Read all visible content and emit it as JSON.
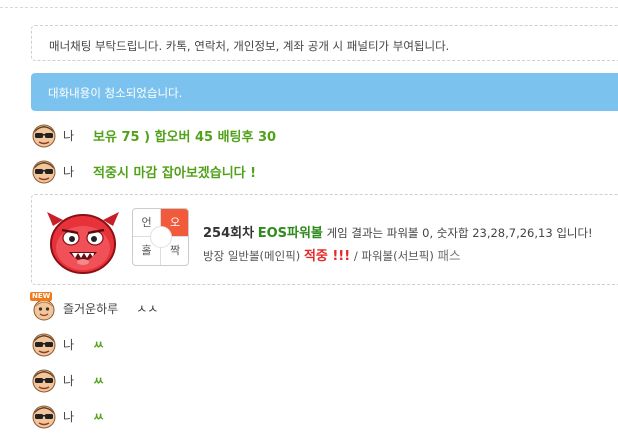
{
  "notice": {
    "text": "매너채팅 부탁드립니다. 카톡, 연락처, 개인정보, 계좌 공개 시 패널티가 부여됩니다."
  },
  "system": {
    "cleared_text": "대화내용이 청소되었습니다."
  },
  "messages": [
    {
      "nick": "나",
      "text": "보유 75 ) 합오버 45 배팅후 30",
      "avatar": "sunglasses-avatar-icon"
    },
    {
      "nick": "나",
      "text": "적중시 마감 잡아보겠습니다 !",
      "avatar": "sunglasses-avatar-icon"
    }
  ],
  "result": {
    "grid": {
      "top_left": "언",
      "top_right": "오",
      "bottom_left": "홀",
      "bottom_right": "짝"
    },
    "round": "254회차",
    "game": "EOS파워볼",
    "sentence": "게임 결과는 파워볼 0, 숫자합 23,28,7,26,13 입니다!",
    "line2_prefix": "방장 일반볼(메인픽)",
    "hit": "적중 !!!",
    "line2_mid": "/ 파워볼(서브픽)",
    "pass": "패스",
    "colors": {
      "accent_red": "#f15a3a",
      "game_green": "#2f8a1c",
      "hit_red": "#e22a2a"
    }
  },
  "chat": [
    {
      "nick": "즐거운하루",
      "text": "ㅅㅅ",
      "avatar": "new-user-avatar-icon",
      "badge": "NEW"
    },
    {
      "nick": "나",
      "text": "ㅆ",
      "avatar": "sunglasses-avatar-icon"
    },
    {
      "nick": "나",
      "text": "ㅆ",
      "avatar": "sunglasses-avatar-icon"
    },
    {
      "nick": "나",
      "text": "ㅆ",
      "avatar": "sunglasses-avatar-icon"
    }
  ],
  "theme": {
    "system_bg": "#7bc3ee",
    "message_green": "#52a11a"
  }
}
